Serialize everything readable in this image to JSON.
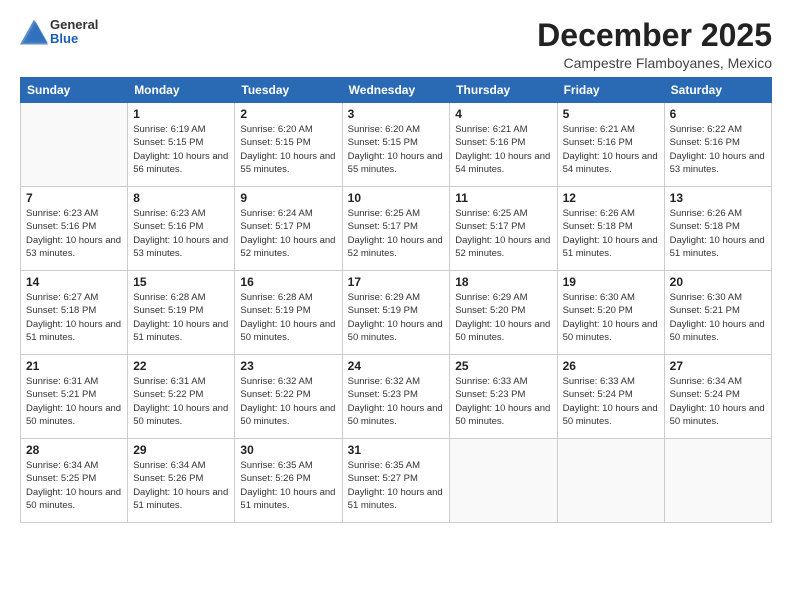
{
  "header": {
    "logo_general": "General",
    "logo_blue": "Blue",
    "month": "December 2025",
    "location": "Campestre Flamboyanes, Mexico"
  },
  "days_of_week": [
    "Sunday",
    "Monday",
    "Tuesday",
    "Wednesday",
    "Thursday",
    "Friday",
    "Saturday"
  ],
  "weeks": [
    [
      {
        "day": "",
        "empty": true
      },
      {
        "day": "1",
        "sunrise": "6:19 AM",
        "sunset": "5:15 PM",
        "daylight": "10 hours and 56 minutes."
      },
      {
        "day": "2",
        "sunrise": "6:20 AM",
        "sunset": "5:15 PM",
        "daylight": "10 hours and 55 minutes."
      },
      {
        "day": "3",
        "sunrise": "6:20 AM",
        "sunset": "5:15 PM",
        "daylight": "10 hours and 55 minutes."
      },
      {
        "day": "4",
        "sunrise": "6:21 AM",
        "sunset": "5:16 PM",
        "daylight": "10 hours and 54 minutes."
      },
      {
        "day": "5",
        "sunrise": "6:21 AM",
        "sunset": "5:16 PM",
        "daylight": "10 hours and 54 minutes."
      },
      {
        "day": "6",
        "sunrise": "6:22 AM",
        "sunset": "5:16 PM",
        "daylight": "10 hours and 53 minutes."
      }
    ],
    [
      {
        "day": "7",
        "sunrise": "6:23 AM",
        "sunset": "5:16 PM",
        "daylight": "10 hours and 53 minutes."
      },
      {
        "day": "8",
        "sunrise": "6:23 AM",
        "sunset": "5:16 PM",
        "daylight": "10 hours and 53 minutes."
      },
      {
        "day": "9",
        "sunrise": "6:24 AM",
        "sunset": "5:17 PM",
        "daylight": "10 hours and 52 minutes."
      },
      {
        "day": "10",
        "sunrise": "6:25 AM",
        "sunset": "5:17 PM",
        "daylight": "10 hours and 52 minutes."
      },
      {
        "day": "11",
        "sunrise": "6:25 AM",
        "sunset": "5:17 PM",
        "daylight": "10 hours and 52 minutes."
      },
      {
        "day": "12",
        "sunrise": "6:26 AM",
        "sunset": "5:18 PM",
        "daylight": "10 hours and 51 minutes."
      },
      {
        "day": "13",
        "sunrise": "6:26 AM",
        "sunset": "5:18 PM",
        "daylight": "10 hours and 51 minutes."
      }
    ],
    [
      {
        "day": "14",
        "sunrise": "6:27 AM",
        "sunset": "5:18 PM",
        "daylight": "10 hours and 51 minutes."
      },
      {
        "day": "15",
        "sunrise": "6:28 AM",
        "sunset": "5:19 PM",
        "daylight": "10 hours and 51 minutes."
      },
      {
        "day": "16",
        "sunrise": "6:28 AM",
        "sunset": "5:19 PM",
        "daylight": "10 hours and 50 minutes."
      },
      {
        "day": "17",
        "sunrise": "6:29 AM",
        "sunset": "5:19 PM",
        "daylight": "10 hours and 50 minutes."
      },
      {
        "day": "18",
        "sunrise": "6:29 AM",
        "sunset": "5:20 PM",
        "daylight": "10 hours and 50 minutes."
      },
      {
        "day": "19",
        "sunrise": "6:30 AM",
        "sunset": "5:20 PM",
        "daylight": "10 hours and 50 minutes."
      },
      {
        "day": "20",
        "sunrise": "6:30 AM",
        "sunset": "5:21 PM",
        "daylight": "10 hours and 50 minutes."
      }
    ],
    [
      {
        "day": "21",
        "sunrise": "6:31 AM",
        "sunset": "5:21 PM",
        "daylight": "10 hours and 50 minutes."
      },
      {
        "day": "22",
        "sunrise": "6:31 AM",
        "sunset": "5:22 PM",
        "daylight": "10 hours and 50 minutes."
      },
      {
        "day": "23",
        "sunrise": "6:32 AM",
        "sunset": "5:22 PM",
        "daylight": "10 hours and 50 minutes."
      },
      {
        "day": "24",
        "sunrise": "6:32 AM",
        "sunset": "5:23 PM",
        "daylight": "10 hours and 50 minutes."
      },
      {
        "day": "25",
        "sunrise": "6:33 AM",
        "sunset": "5:23 PM",
        "daylight": "10 hours and 50 minutes."
      },
      {
        "day": "26",
        "sunrise": "6:33 AM",
        "sunset": "5:24 PM",
        "daylight": "10 hours and 50 minutes."
      },
      {
        "day": "27",
        "sunrise": "6:34 AM",
        "sunset": "5:24 PM",
        "daylight": "10 hours and 50 minutes."
      }
    ],
    [
      {
        "day": "28",
        "sunrise": "6:34 AM",
        "sunset": "5:25 PM",
        "daylight": "10 hours and 50 minutes."
      },
      {
        "day": "29",
        "sunrise": "6:34 AM",
        "sunset": "5:26 PM",
        "daylight": "10 hours and 51 minutes."
      },
      {
        "day": "30",
        "sunrise": "6:35 AM",
        "sunset": "5:26 PM",
        "daylight": "10 hours and 51 minutes."
      },
      {
        "day": "31",
        "sunrise": "6:35 AM",
        "sunset": "5:27 PM",
        "daylight": "10 hours and 51 minutes."
      },
      {
        "day": "",
        "empty": true
      },
      {
        "day": "",
        "empty": true
      },
      {
        "day": "",
        "empty": true
      }
    ]
  ]
}
